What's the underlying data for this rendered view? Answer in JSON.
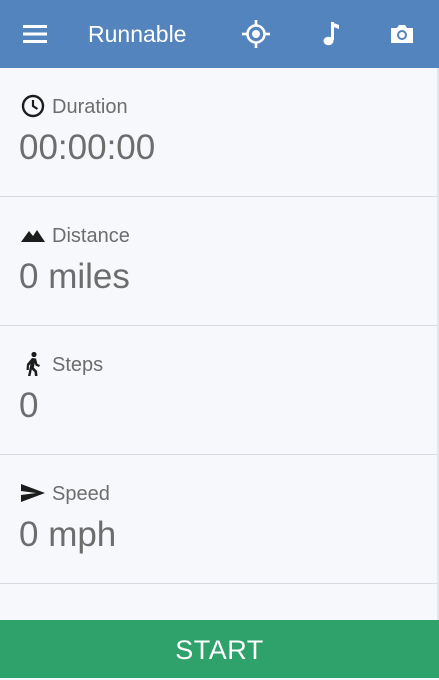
{
  "app": {
    "title": "Runnable"
  },
  "toolbar": {
    "icons": [
      "menu-icon",
      "location-target-icon",
      "music-note-icon",
      "camera-icon"
    ]
  },
  "stats": [
    {
      "icon": "clock-icon",
      "label": "Duration",
      "value": "00:00:00"
    },
    {
      "icon": "terrain-icon",
      "label": "Distance",
      "value": "0 miles"
    },
    {
      "icon": "walking-icon",
      "label": "Steps",
      "value": "0"
    },
    {
      "icon": "send-icon",
      "label": "Speed",
      "value": "0 mph"
    }
  ],
  "actions": {
    "start_label": "START"
  },
  "colors": {
    "toolbar": "#5484bd",
    "start_button": "#2fa26b",
    "text": "#6d6d6d"
  }
}
